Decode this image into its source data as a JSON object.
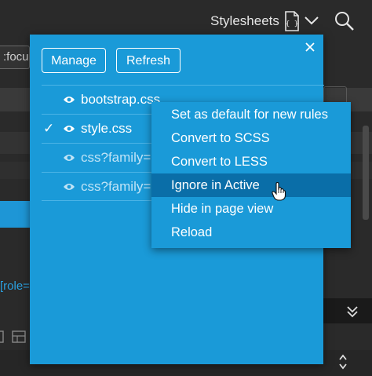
{
  "header": {
    "title": "Stylesheets"
  },
  "background": {
    "input_fragment": ":focu",
    "role_fragment": "[role="
  },
  "popover": {
    "manage_label": "Manage",
    "refresh_label": "Refresh",
    "sheets": [
      {
        "name": "bootstrap.css",
        "checked": false,
        "dim": false
      },
      {
        "name": "style.css",
        "checked": true,
        "dim": false
      },
      {
        "name": "css?family=l",
        "checked": false,
        "dim": true
      },
      {
        "name": "css?family=l",
        "checked": false,
        "dim": true
      }
    ],
    "check_glyph": "✓"
  },
  "context_menu": {
    "items": [
      "Set as default for new rules",
      "Convert to SCSS",
      "Convert to LESS",
      "Ignore in Active",
      "Hide in page view",
      "Reload"
    ],
    "highlighted_index": 3
  },
  "colors": {
    "accent_blue": "#1a9ad8",
    "highlight": "#0a6ea8",
    "background": "#2a2a2a"
  }
}
